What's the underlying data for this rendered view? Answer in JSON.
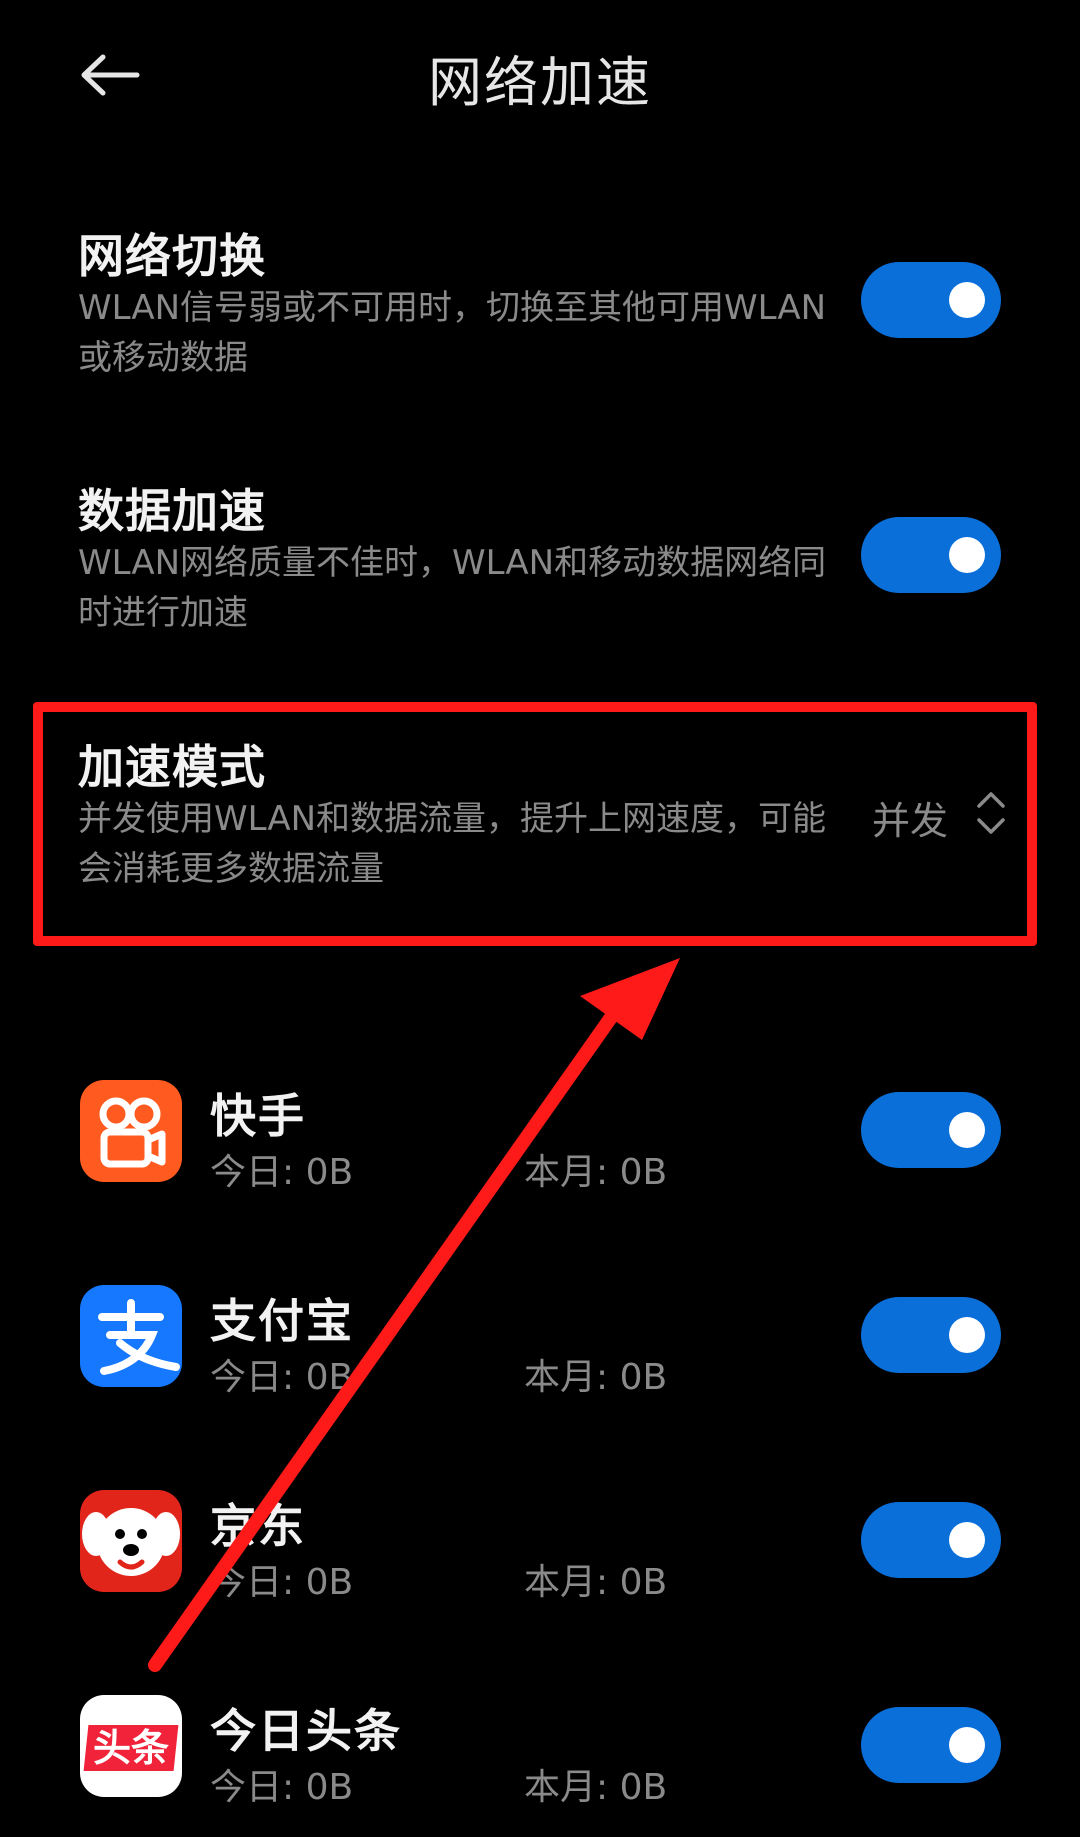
{
  "header": {
    "title": "网络加速"
  },
  "settings": [
    {
      "title": "网络切换",
      "desc": "WLAN信号弱或不可用时，切换至其他可用WLAN或移动数据",
      "enabled": true
    },
    {
      "title": "数据加速",
      "desc": "WLAN网络质量不佳时，WLAN和移动数据网络同时进行加速",
      "enabled": true
    },
    {
      "title": "加速模式",
      "desc": "并发使用WLAN和数据流量，提升上网速度，可能会消耗更多数据流量",
      "value": "并发"
    }
  ],
  "apps": [
    {
      "name": "快手",
      "today": "今日: 0B",
      "month": "本月: 0B",
      "enabled": true,
      "icon": "kuaishou-icon"
    },
    {
      "name": "支付宝",
      "today": "今日: 0B",
      "month": "本月: 0B",
      "enabled": true,
      "icon": "alipay-icon"
    },
    {
      "name": "京东",
      "today": "今日: 0B",
      "month": "本月: 0B",
      "enabled": true,
      "icon": "jd-icon"
    },
    {
      "name": "今日头条",
      "today": "今日: 0B",
      "month": "本月: 0B",
      "enabled": true,
      "icon": "toutiao-icon",
      "icon_text": "头条"
    }
  ],
  "colors": {
    "background": "#000000",
    "toggle_on": "#0a6fd8",
    "highlight": "#ff1a1a",
    "secondary_text": "#8a8a8a"
  }
}
